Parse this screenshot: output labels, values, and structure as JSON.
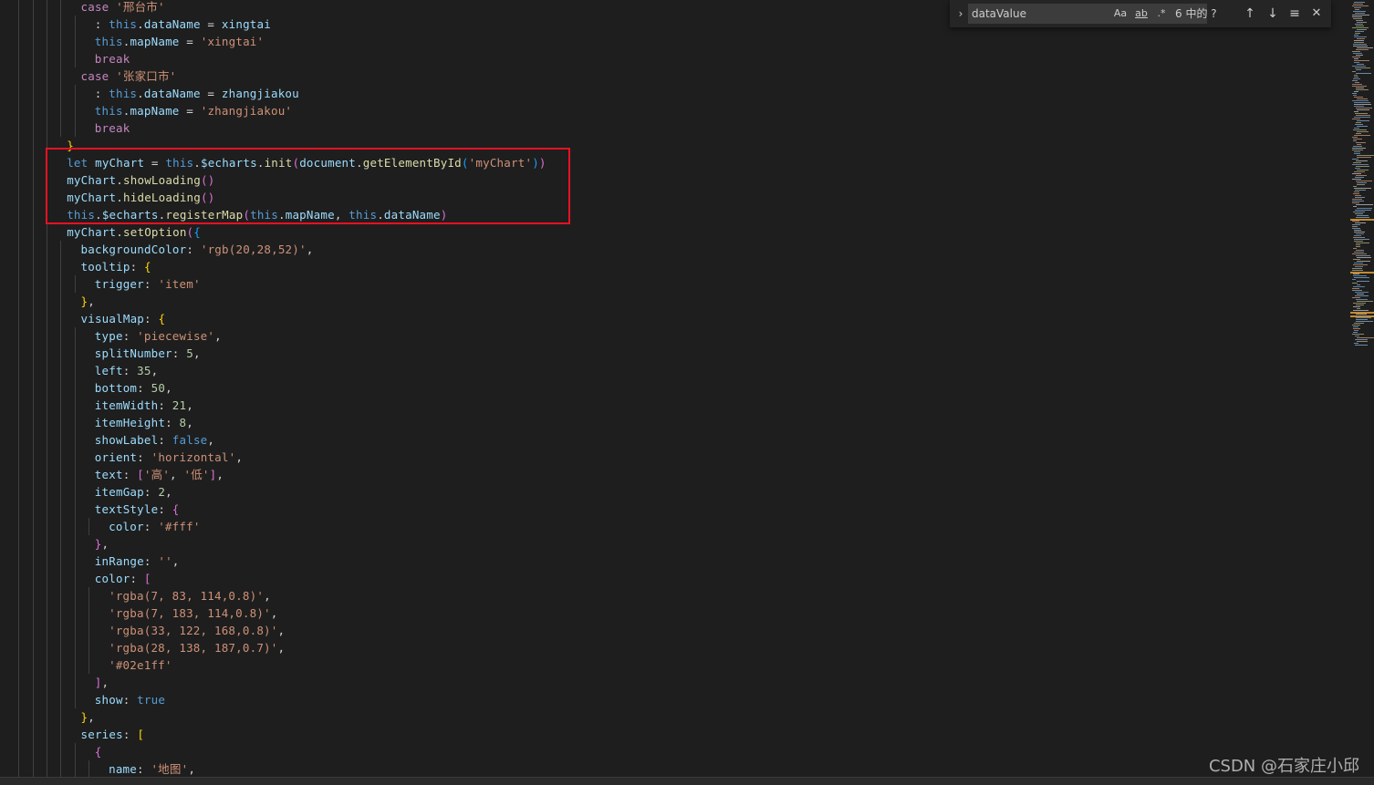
{
  "editor": {
    "lines": [
      {
        "indent": 5,
        "tokens": [
          [
            "kw",
            "case "
          ],
          [
            "str",
            "'邢台市'"
          ]
        ]
      },
      {
        "indent": 6,
        "tokens": [
          [
            "pun",
            ": "
          ],
          [
            "this",
            "this"
          ],
          [
            "pun",
            "."
          ],
          [
            "prop",
            "dataName"
          ],
          [
            "pun",
            " = "
          ],
          [
            "prop",
            "xingtai"
          ]
        ]
      },
      {
        "indent": 6,
        "tokens": [
          [
            "this",
            "this"
          ],
          [
            "pun",
            "."
          ],
          [
            "prop",
            "mapName"
          ],
          [
            "pun",
            " = "
          ],
          [
            "str",
            "'xingtai'"
          ]
        ]
      },
      {
        "indent": 6,
        "tokens": [
          [
            "kw",
            "break"
          ]
        ]
      },
      {
        "indent": 5,
        "tokens": [
          [
            "kw",
            "case "
          ],
          [
            "str",
            "'张家口市'"
          ]
        ]
      },
      {
        "indent": 6,
        "tokens": [
          [
            "pun",
            ": "
          ],
          [
            "this",
            "this"
          ],
          [
            "pun",
            "."
          ],
          [
            "prop",
            "dataName"
          ],
          [
            "pun",
            " = "
          ],
          [
            "prop",
            "zhangjiakou"
          ]
        ]
      },
      {
        "indent": 6,
        "tokens": [
          [
            "this",
            "this"
          ],
          [
            "pun",
            "."
          ],
          [
            "prop",
            "mapName"
          ],
          [
            "pun",
            " = "
          ],
          [
            "str",
            "'zhangjiakou'"
          ]
        ]
      },
      {
        "indent": 6,
        "tokens": [
          [
            "kw",
            "break"
          ]
        ]
      },
      {
        "indent": 4,
        "tokens": [
          [
            "brace",
            "}"
          ]
        ]
      },
      {
        "indent": 4,
        "tokens": [
          [
            "this",
            "let "
          ],
          [
            "prop",
            "myChart"
          ],
          [
            "pun",
            " = "
          ],
          [
            "this",
            "this"
          ],
          [
            "pun",
            "."
          ],
          [
            "prop",
            "$echarts"
          ],
          [
            "pun",
            "."
          ],
          [
            "fn",
            "init"
          ],
          [
            "paren",
            "("
          ],
          [
            "prop",
            "document"
          ],
          [
            "pun",
            "."
          ],
          [
            "fn",
            "getElementById"
          ],
          [
            "bracket",
            "("
          ],
          [
            "str",
            "'myChart'"
          ],
          [
            "bracket",
            ")"
          ],
          [
            "paren",
            ")"
          ]
        ]
      },
      {
        "indent": 4,
        "tokens": [
          [
            "prop",
            "myChart"
          ],
          [
            "pun",
            "."
          ],
          [
            "fn",
            "showLoading"
          ],
          [
            "paren",
            "()"
          ]
        ]
      },
      {
        "indent": 4,
        "tokens": [
          [
            "prop",
            "myChart"
          ],
          [
            "pun",
            "."
          ],
          [
            "fn",
            "hideLoading"
          ],
          [
            "paren",
            "()"
          ]
        ]
      },
      {
        "indent": 4,
        "tokens": [
          [
            "this",
            "this"
          ],
          [
            "pun",
            "."
          ],
          [
            "prop",
            "$echarts"
          ],
          [
            "pun",
            "."
          ],
          [
            "fn",
            "registerMap"
          ],
          [
            "paren",
            "("
          ],
          [
            "this",
            "this"
          ],
          [
            "pun",
            "."
          ],
          [
            "prop",
            "mapName"
          ],
          [
            "pun",
            ", "
          ],
          [
            "this",
            "this"
          ],
          [
            "pun",
            "."
          ],
          [
            "prop",
            "dataName"
          ],
          [
            "paren",
            ")"
          ]
        ]
      },
      {
        "indent": 4,
        "tokens": [
          [
            "prop",
            "myChart"
          ],
          [
            "pun",
            "."
          ],
          [
            "fn",
            "setOption"
          ],
          [
            "paren",
            "("
          ],
          [
            "bracket",
            "{"
          ]
        ]
      },
      {
        "indent": 5,
        "tokens": [
          [
            "prop",
            "backgroundColor"
          ],
          [
            "pun",
            ": "
          ],
          [
            "str",
            "'rgb(20,28,52)'"
          ],
          [
            "pun",
            ","
          ]
        ]
      },
      {
        "indent": 5,
        "tokens": [
          [
            "prop",
            "tooltip"
          ],
          [
            "pun",
            ": "
          ],
          [
            "brace",
            "{"
          ]
        ]
      },
      {
        "indent": 6,
        "tokens": [
          [
            "prop",
            "trigger"
          ],
          [
            "pun",
            ": "
          ],
          [
            "str",
            "'item'"
          ]
        ]
      },
      {
        "indent": 5,
        "tokens": [
          [
            "brace",
            "}"
          ],
          [
            "pun",
            ","
          ]
        ]
      },
      {
        "indent": 5,
        "tokens": [
          [
            "prop",
            "visualMap"
          ],
          [
            "pun",
            ": "
          ],
          [
            "brace",
            "{"
          ]
        ]
      },
      {
        "indent": 6,
        "tokens": [
          [
            "prop",
            "type"
          ],
          [
            "pun",
            ": "
          ],
          [
            "str",
            "'piecewise'"
          ],
          [
            "pun",
            ","
          ]
        ]
      },
      {
        "indent": 6,
        "tokens": [
          [
            "prop",
            "splitNumber"
          ],
          [
            "pun",
            ": "
          ],
          [
            "num",
            "5"
          ],
          [
            "pun",
            ","
          ]
        ]
      },
      {
        "indent": 6,
        "tokens": [
          [
            "prop",
            "left"
          ],
          [
            "pun",
            ": "
          ],
          [
            "num",
            "35"
          ],
          [
            "pun",
            ","
          ]
        ]
      },
      {
        "indent": 6,
        "tokens": [
          [
            "prop",
            "bottom"
          ],
          [
            "pun",
            ": "
          ],
          [
            "num",
            "50"
          ],
          [
            "pun",
            ","
          ]
        ]
      },
      {
        "indent": 6,
        "tokens": [
          [
            "prop",
            "itemWidth"
          ],
          [
            "pun",
            ": "
          ],
          [
            "num",
            "21"
          ],
          [
            "pun",
            ","
          ]
        ]
      },
      {
        "indent": 6,
        "tokens": [
          [
            "prop",
            "itemHeight"
          ],
          [
            "pun",
            ": "
          ],
          [
            "num",
            "8"
          ],
          [
            "pun",
            ","
          ]
        ]
      },
      {
        "indent": 6,
        "tokens": [
          [
            "prop",
            "showLabel"
          ],
          [
            "pun",
            ": "
          ],
          [
            "this",
            "false"
          ],
          [
            "pun",
            ","
          ]
        ]
      },
      {
        "indent": 6,
        "tokens": [
          [
            "prop",
            "orient"
          ],
          [
            "pun",
            ": "
          ],
          [
            "str",
            "'horizontal'"
          ],
          [
            "pun",
            ","
          ]
        ]
      },
      {
        "indent": 6,
        "tokens": [
          [
            "prop",
            "text"
          ],
          [
            "pun",
            ": "
          ],
          [
            "paren",
            "["
          ],
          [
            "str",
            "'高'"
          ],
          [
            "pun",
            ", "
          ],
          [
            "str",
            "'低'"
          ],
          [
            "paren",
            "]"
          ],
          [
            "pun",
            ","
          ]
        ]
      },
      {
        "indent": 6,
        "tokens": [
          [
            "prop",
            "itemGap"
          ],
          [
            "pun",
            ": "
          ],
          [
            "num",
            "2"
          ],
          [
            "pun",
            ","
          ]
        ]
      },
      {
        "indent": 6,
        "tokens": [
          [
            "prop",
            "textStyle"
          ],
          [
            "pun",
            ": "
          ],
          [
            "paren",
            "{"
          ]
        ]
      },
      {
        "indent": 7,
        "tokens": [
          [
            "prop",
            "color"
          ],
          [
            "pun",
            ": "
          ],
          [
            "str",
            "'#fff'"
          ]
        ]
      },
      {
        "indent": 6,
        "tokens": [
          [
            "paren",
            "}"
          ],
          [
            "pun",
            ","
          ]
        ]
      },
      {
        "indent": 6,
        "tokens": [
          [
            "prop",
            "inRange"
          ],
          [
            "pun",
            ": "
          ],
          [
            "str",
            "''"
          ],
          [
            "pun",
            ","
          ]
        ]
      },
      {
        "indent": 6,
        "tokens": [
          [
            "prop",
            "color"
          ],
          [
            "pun",
            ": "
          ],
          [
            "paren",
            "["
          ]
        ]
      },
      {
        "indent": 7,
        "tokens": [
          [
            "str",
            "'rgba(7, 83, 114,0.8)'"
          ],
          [
            "pun",
            ","
          ]
        ]
      },
      {
        "indent": 7,
        "tokens": [
          [
            "str",
            "'rgba(7, 183, 114,0.8)'"
          ],
          [
            "pun",
            ","
          ]
        ]
      },
      {
        "indent": 7,
        "tokens": [
          [
            "str",
            "'rgba(33, 122, 168,0.8)'"
          ],
          [
            "pun",
            ","
          ]
        ]
      },
      {
        "indent": 7,
        "tokens": [
          [
            "str",
            "'rgba(28, 138, 187,0.7)'"
          ],
          [
            "pun",
            ","
          ]
        ]
      },
      {
        "indent": 7,
        "tokens": [
          [
            "str",
            "'#02e1ff'"
          ]
        ]
      },
      {
        "indent": 6,
        "tokens": [
          [
            "paren",
            "]"
          ],
          [
            "pun",
            ","
          ]
        ]
      },
      {
        "indent": 6,
        "tokens": [
          [
            "prop",
            "show"
          ],
          [
            "pun",
            ": "
          ],
          [
            "this",
            "true"
          ]
        ]
      },
      {
        "indent": 5,
        "tokens": [
          [
            "brace",
            "}"
          ],
          [
            "pun",
            ","
          ]
        ]
      },
      {
        "indent": 5,
        "tokens": [
          [
            "prop",
            "series"
          ],
          [
            "pun",
            ": "
          ],
          [
            "brace",
            "["
          ]
        ]
      },
      {
        "indent": 6,
        "tokens": [
          [
            "paren",
            "{"
          ]
        ]
      },
      {
        "indent": 7,
        "tokens": [
          [
            "prop",
            "name"
          ],
          [
            "pun",
            ": "
          ],
          [
            "str",
            "'地图'"
          ],
          [
            "pun",
            ","
          ]
        ]
      }
    ]
  },
  "find": {
    "query": "dataValue",
    "match_case": "Aa",
    "whole_word": "ab",
    "regex": ".*",
    "count": "6 中的 ?",
    "prev": "↑",
    "next": "↓",
    "selection": "≡",
    "close": "✕",
    "toggle": "›"
  },
  "colors": {
    "highlight_box": "#e81123",
    "editor_bg": "#1e1e1e"
  },
  "watermark": "CSDN @石家庄小邱"
}
